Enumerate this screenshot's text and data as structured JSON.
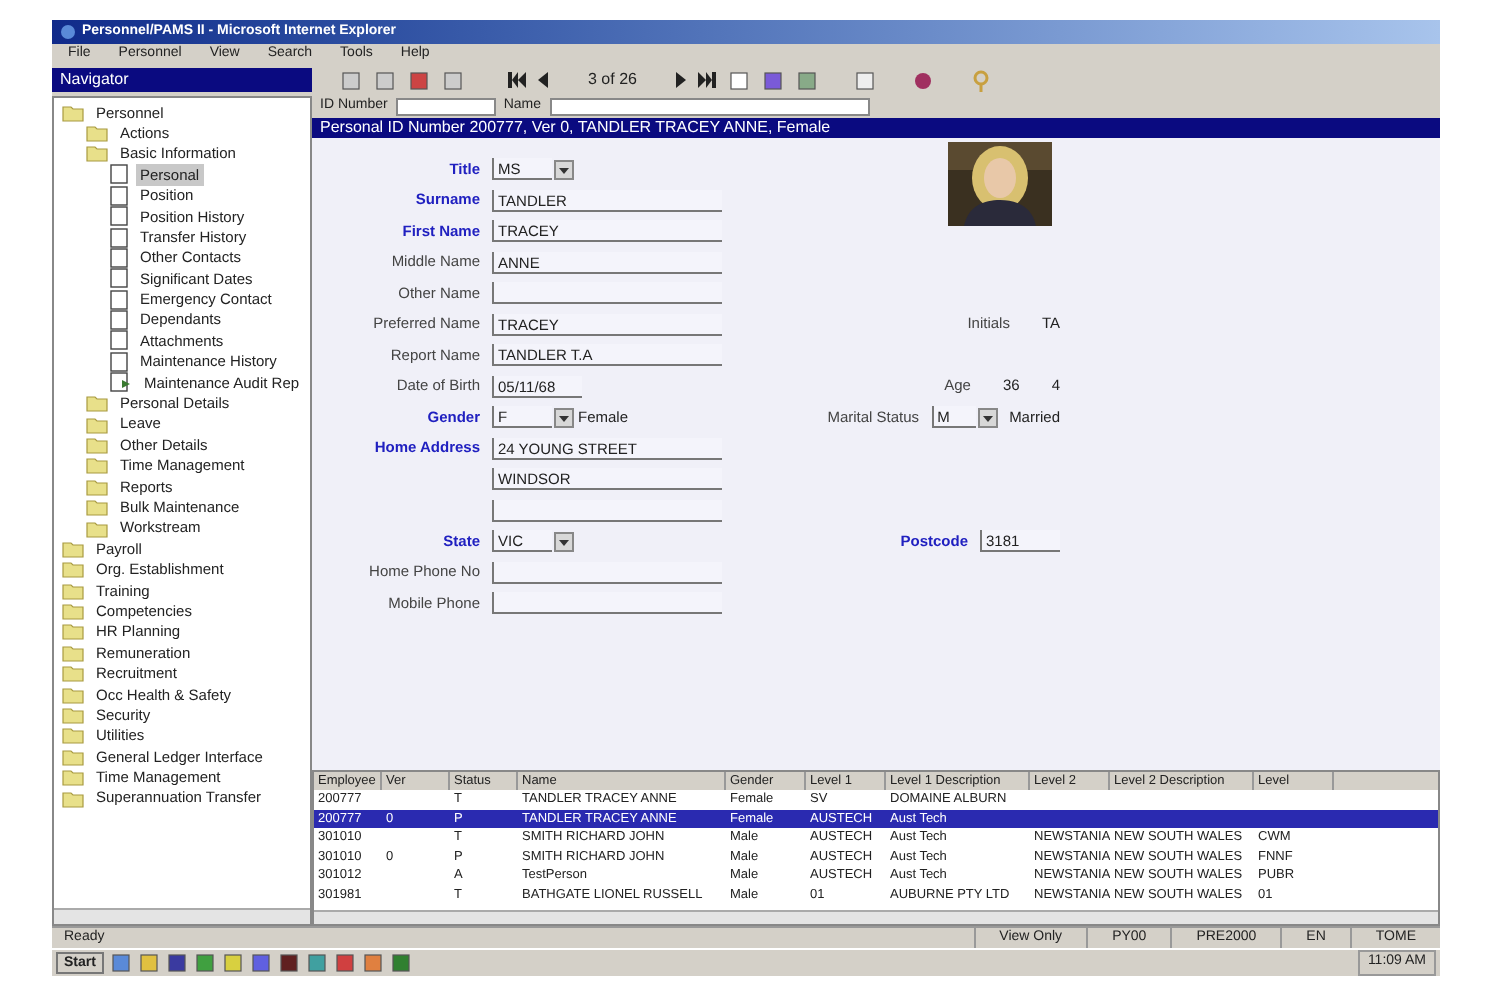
{
  "window": {
    "title": "Personnel/PAMS II - Microsoft Internet Explorer"
  },
  "menu": [
    "File",
    "Personnel",
    "View",
    "Search",
    "Tools",
    "Help"
  ],
  "navigator": {
    "title": "Navigator"
  },
  "toolbar": {
    "record": "3 of 26"
  },
  "search": {
    "id_label": "ID Number",
    "name_label": "Name"
  },
  "header": "Personal ID Number 200777, Ver 0, TANDLER TRACEY ANNE, Female",
  "tree": [
    {
      "label": "Personnel",
      "kind": "folder",
      "selected": false,
      "children": [
        {
          "label": "Actions",
          "kind": "folder",
          "selected": false
        },
        {
          "label": "Basic Information",
          "kind": "folder",
          "selected": false,
          "children": [
            {
              "label": "Personal",
              "kind": "page",
              "selected": true
            },
            {
              "label": "Position",
              "kind": "page",
              "selected": false
            },
            {
              "label": "Position History",
              "kind": "page",
              "selected": false
            },
            {
              "label": "Transfer History",
              "kind": "page",
              "selected": false
            },
            {
              "label": "Other Contacts",
              "kind": "page",
              "selected": false
            },
            {
              "label": "Significant Dates",
              "kind": "page",
              "selected": false
            },
            {
              "label": "Emergency Contact",
              "kind": "page",
              "selected": false
            },
            {
              "label": "Dependants",
              "kind": "page",
              "selected": false
            },
            {
              "label": "Attachments",
              "kind": "page",
              "selected": false
            },
            {
              "label": "Maintenance History",
              "kind": "page",
              "selected": false
            },
            {
              "label": "Maintenance Audit Rep",
              "kind": "report",
              "selected": false
            }
          ]
        },
        {
          "label": "Personal Details",
          "kind": "folder",
          "selected": false
        },
        {
          "label": "Leave",
          "kind": "folder",
          "selected": false
        },
        {
          "label": "Other Details",
          "kind": "folder",
          "selected": false
        },
        {
          "label": "Time Management",
          "kind": "folder",
          "selected": false
        },
        {
          "label": "Reports",
          "kind": "folder",
          "selected": false
        },
        {
          "label": "Bulk Maintenance",
          "kind": "folder",
          "selected": false
        },
        {
          "label": "Workstream",
          "kind": "folder",
          "selected": false
        }
      ]
    },
    {
      "label": "Payroll",
      "kind": "folder",
      "selected": false
    },
    {
      "label": "Org. Establishment",
      "kind": "folder",
      "selected": false
    },
    {
      "label": "Training",
      "kind": "folder",
      "selected": false
    },
    {
      "label": "Competencies",
      "kind": "folder",
      "selected": false
    },
    {
      "label": "HR Planning",
      "kind": "folder",
      "selected": false
    },
    {
      "label": "Remuneration",
      "kind": "folder",
      "selected": false
    },
    {
      "label": "Recruitment",
      "kind": "folder",
      "selected": false
    },
    {
      "label": "Occ Health & Safety",
      "kind": "folder",
      "selected": false
    },
    {
      "label": "Security",
      "kind": "folder",
      "selected": false
    },
    {
      "label": "Utilities",
      "kind": "folder",
      "selected": false
    },
    {
      "label": "General Ledger Interface",
      "kind": "folder",
      "selected": false
    },
    {
      "label": "Time Management",
      "kind": "folder",
      "selected": false
    },
    {
      "label": "Superannuation Transfer",
      "kind": "folder",
      "selected": false
    }
  ],
  "form": [
    {
      "label": "Title",
      "required": true,
      "kind": "combo",
      "value": "MS"
    },
    {
      "label": "Surname",
      "required": true,
      "kind": "text",
      "value": "TANDLER"
    },
    {
      "label": "First Name",
      "required": true,
      "kind": "text",
      "value": "TRACEY"
    },
    {
      "label": "Middle Name",
      "required": false,
      "kind": "text",
      "value": "ANNE"
    },
    {
      "label": "Other Name",
      "required": false,
      "kind": "text"
    },
    {
      "label": "Preferred Name",
      "required": false,
      "kind": "text",
      "value": "TRACEY",
      "side": {
        "label": "Initials",
        "required": false,
        "values": [
          "TA"
        ]
      }
    },
    {
      "label": "Report Name",
      "required": false,
      "kind": "text",
      "value": "TANDLER T.A"
    },
    {
      "label": "Date of Birth",
      "required": false,
      "kind": "date",
      "value": "05/11/68",
      "side": {
        "label": "Age",
        "required": false,
        "values": [
          "36",
          "4"
        ]
      }
    },
    {
      "label": "Gender",
      "required": true,
      "kind": "combo",
      "value": "F",
      "description": "Female",
      "side": {
        "label": "Marital Status",
        "required": false,
        "combo": "M",
        "description": "Married"
      }
    },
    {
      "label": "Home Address",
      "required": true,
      "kind": "text",
      "value": "24 YOUNG STREET"
    },
    {
      "kind": "text",
      "value": "WINDSOR"
    },
    {
      "kind": "text"
    },
    {
      "label": "State",
      "required": true,
      "kind": "combo",
      "value": "VIC",
      "side": {
        "label": "Postcode",
        "required": true,
        "field": "3181"
      }
    },
    {
      "label": "Home Phone No",
      "required": false,
      "kind": "text"
    },
    {
      "label": "Mobile Phone",
      "required": false,
      "kind": "text"
    }
  ],
  "table": {
    "columns": [
      "Employee",
      "Ver",
      "Status",
      "Name",
      "Gender",
      "Level 1",
      "Level 1 Description",
      "Level 2",
      "Level 2 Description",
      "Level"
    ],
    "rows": [
      {
        "selected": false,
        "cells": [
          "200777",
          "",
          "T",
          "TANDLER TRACEY ANNE",
          "Female",
          "SV",
          "DOMAINE ALBURN",
          "",
          "",
          ""
        ]
      },
      {
        "selected": true,
        "cells": [
          "200777",
          "0",
          "P",
          "TANDLER TRACEY ANNE",
          "Female",
          "AUSTECH",
          "Aust Tech",
          "",
          "",
          ""
        ]
      },
      {
        "selected": false,
        "cells": [
          "301010",
          "",
          "T",
          "SMITH RICHARD JOHN",
          "Male",
          "AUSTECH",
          "Aust Tech",
          "NEWSTANIA",
          "NEW SOUTH WALES",
          "CWM"
        ]
      },
      {
        "selected": false,
        "cells": [
          "301010",
          "0",
          "P",
          "SMITH RICHARD JOHN",
          "Male",
          "AUSTECH",
          "Aust Tech",
          "NEWSTANIA",
          "NEW SOUTH WALES",
          "FNNF"
        ]
      },
      {
        "selected": false,
        "cells": [
          "301012",
          "",
          "A",
          "TestPerson",
          "Male",
          "AUSTECH",
          "Aust Tech",
          "NEWSTANIA",
          "NEW SOUTH WALES",
          "PUBR"
        ]
      },
      {
        "selected": false,
        "cells": [
          "301981",
          "",
          "T",
          "BATHGATE LIONEL RUSSELL",
          "Male",
          "01",
          "AUBURNE PTY LTD",
          "NEWSTANIA",
          "NEW SOUTH WALES",
          "01"
        ]
      }
    ]
  },
  "status_bar": [
    "Ready",
    "View Only",
    "PY00",
    "PRE2000",
    "EN",
    "TOME"
  ],
  "taskbar": {
    "start": "Start",
    "clock": "11:09 AM"
  }
}
